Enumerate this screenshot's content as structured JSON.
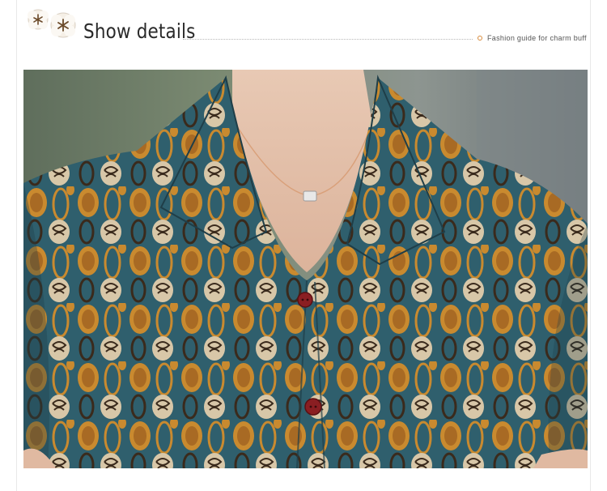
{
  "header": {
    "title": "Show details",
    "subtitle": "Fashion guide for charm buff",
    "decoration_icon": "cotton-flower-icon",
    "accent_color": "#d88a3a"
  },
  "photo": {
    "subject": "product-detail-photo",
    "fabric_colors": [
      "#2e5f6e",
      "#c98a2f",
      "#3a2a1c",
      "#e8dcc4"
    ],
    "button_color": "#8a1e22"
  }
}
